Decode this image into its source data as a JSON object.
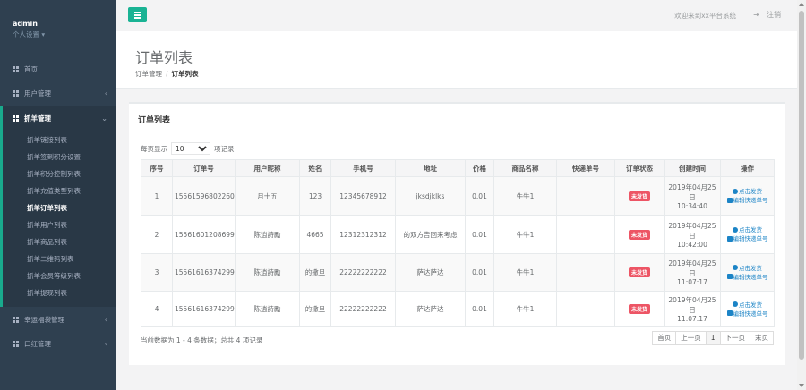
{
  "sidebar": {
    "user": "admin",
    "settings": "个人设置 ▾",
    "items": [
      {
        "label": "首页"
      },
      {
        "label": "用户管理",
        "arrow": "‹"
      },
      {
        "label": "抓羊管理",
        "arrow": "⌄"
      },
      {
        "label": "幸运福袋管理",
        "arrow": "‹"
      },
      {
        "label": "口红管理",
        "arrow": "‹"
      }
    ],
    "submenu": [
      "抓羊链接列表",
      "抓羊签到积分设置",
      "抓羊积分控制列表",
      "抓羊充值类型列表",
      "抓羊订单列表",
      "抓羊用户列表",
      "抓羊商品列表",
      "抓羊二维码列表",
      "抓羊会员等级列表",
      "抓羊提现列表"
    ]
  },
  "topbar": {
    "welcome": "欢迎来到xx平台系统",
    "logout_icon": "⇥",
    "logout": "注销"
  },
  "heading": {
    "title": "订单列表",
    "crumb_parent": "订单管理",
    "crumb_sep": "/",
    "crumb_current": "订单列表"
  },
  "panel": {
    "title": "订单列表",
    "len_prefix": "每页显示",
    "len_value": "10",
    "len_suffix": "项记录",
    "columns": [
      "序号",
      "订单号",
      "用户昵称",
      "姓名",
      "手机号",
      "地址",
      "价格",
      "商品名称",
      "快递单号",
      "订单状态",
      "创建时间",
      "操作"
    ],
    "rows": [
      {
        "no": "1",
        "order": "15561596802260",
        "nick": "月十五",
        "name": "123",
        "phone": "12345678912",
        "addr": "jksdjklks",
        "price": "0.01",
        "goods": "牛牛1",
        "express": "",
        "status": "未发货",
        "date": "2019年04月25日",
        "time": "10:34:40",
        "ship": "点击发货",
        "edit": "编辑快递单号"
      },
      {
        "no": "2",
        "order": "15561601208699",
        "nick": "陈逍詩勵",
        "name": "4665",
        "phone": "12312312312",
        "addr": "的双方告回来考虑",
        "price": "0.01",
        "goods": "牛牛1",
        "express": "",
        "status": "未发货",
        "date": "2019年04月25日",
        "time": "10:42:00",
        "ship": "点击发货",
        "edit": "编辑快递单号"
      },
      {
        "no": "3",
        "order": "15561616374299",
        "nick": "陈逍詩勵",
        "name": "的撒旦",
        "phone": "22222222222",
        "addr": "萨达萨达",
        "price": "0.01",
        "goods": "牛牛1",
        "express": "",
        "status": "未发货",
        "date": "2019年04月25日",
        "time": "11:07:17",
        "ship": "点击发货",
        "edit": "编辑快递单号"
      },
      {
        "no": "4",
        "order": "15561616374299",
        "nick": "陈逍詩勵",
        "name": "的撒旦",
        "phone": "22222222222",
        "addr": "萨达萨达",
        "price": "0.01",
        "goods": "牛牛1",
        "express": "",
        "status": "未发货",
        "date": "2019年04月25日",
        "time": "11:07:17",
        "ship": "点击发货",
        "edit": "编辑快递单号"
      }
    ],
    "info": "当前数据为 1 - 4 条数据；总共 4 项记录",
    "pager": [
      "首页",
      "上一页",
      "1",
      "下一页",
      "末页"
    ]
  },
  "colors": {
    "sidebar": "#2f4050",
    "accent": "#1ab394",
    "danger": "#ed5565",
    "link": "#1c84c6"
  }
}
